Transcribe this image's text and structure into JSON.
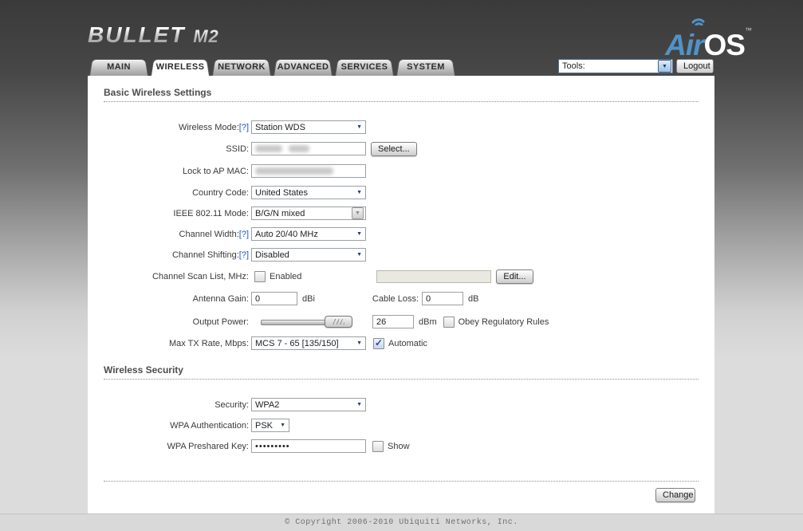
{
  "header": {
    "device": "BULLET",
    "model": "M2",
    "os_air": "Air",
    "os_suffix": "OS",
    "trademark": "™"
  },
  "toolbar": {
    "tools_label": "Tools:",
    "logout_label": "Logout"
  },
  "tabs": [
    {
      "label": "MAIN",
      "active": false
    },
    {
      "label": "WIRELESS",
      "active": true
    },
    {
      "label": "NETWORK",
      "active": false
    },
    {
      "label": "ADVANCED",
      "active": false
    },
    {
      "label": "SERVICES",
      "active": false
    },
    {
      "label": "SYSTEM",
      "active": false
    }
  ],
  "help_label": "[?]",
  "basic": {
    "title": "Basic Wireless Settings",
    "wireless_mode_label": "Wireless Mode:",
    "wireless_mode_value": "Station WDS",
    "ssid_label": "SSID:",
    "ssid_value_redacted": true,
    "ssid_select_button": "Select...",
    "lock_mac_label": "Lock to AP MAC:",
    "lock_mac_value_redacted": true,
    "country_label": "Country Code:",
    "country_value": "United States",
    "ieee_label": "IEEE 802.11 Mode:",
    "ieee_value": "B/G/N mixed",
    "channel_width_label": "Channel Width:",
    "channel_width_value": "Auto 20/40 MHz",
    "channel_shift_label": "Channel Shifting:",
    "channel_shift_value": "Disabled",
    "scan_list_label": "Channel Scan List, MHz:",
    "scan_enabled_label": "Enabled",
    "scan_enabled_checked": false,
    "scan_edit_button": "Edit...",
    "antenna_gain_label": "Antenna Gain:",
    "antenna_gain_value": "0",
    "antenna_gain_unit": "dBi",
    "cable_loss_label": "Cable Loss:",
    "cable_loss_value": "0",
    "cable_loss_unit": "dB",
    "output_power_label": "Output Power:",
    "output_power_value": "26",
    "output_power_unit": "dBm",
    "obey_label": "Obey Regulatory Rules",
    "obey_checked": false,
    "max_tx_label": "Max TX Rate, Mbps:",
    "max_tx_value": "MCS 7 - 65 [135/150]",
    "automatic_label": "Automatic",
    "automatic_checked": true
  },
  "security": {
    "title": "Wireless Security",
    "security_label": "Security:",
    "security_value": "WPA2",
    "wpa_auth_label": "WPA Authentication:",
    "wpa_auth_value": "PSK",
    "wpa_key_label": "WPA Preshared Key:",
    "wpa_key_value": "•••••••••",
    "show_label": "Show",
    "show_checked": false
  },
  "actions": {
    "change_label": "Change"
  },
  "footer": {
    "copyright": "© Copyright 2006-2010 Ubiquiti Networks, Inc."
  }
}
